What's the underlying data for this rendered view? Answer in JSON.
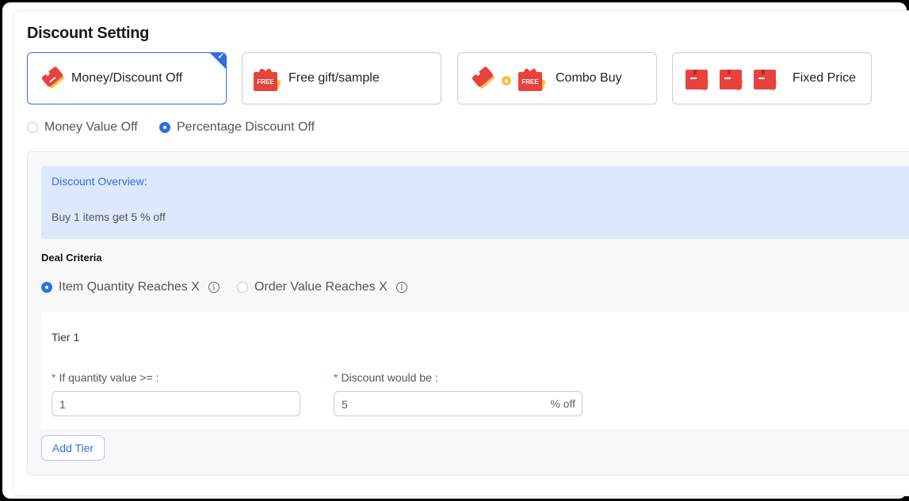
{
  "header": {
    "title": "Discount Setting"
  },
  "discount_types": [
    {
      "label": "Money/Discount Off",
      "icon": "price-tag-icon",
      "selected": true
    },
    {
      "label": "Free gift/sample",
      "icon": "free-gift-icon",
      "selected": false
    },
    {
      "label": "Combo Buy",
      "icon": "combo-icon",
      "selected": false
    },
    {
      "label": "Fixed Price",
      "icon": "fixed-price-icon",
      "selected": false
    }
  ],
  "discount_mode": {
    "options": [
      {
        "label": "Money Value Off",
        "selected": false
      },
      {
        "label": "Percentage Discount Off",
        "selected": true
      }
    ]
  },
  "overview": {
    "title": "Discount Overview:",
    "text": "Buy 1 items get 5 % off"
  },
  "deal_criteria": {
    "title": "Deal Criteria",
    "options": [
      {
        "label": "Item Quantity Reaches X",
        "selected": true
      },
      {
        "label": "Order Value Reaches X",
        "selected": false
      }
    ]
  },
  "tiers": [
    {
      "title": "Tier 1",
      "quantity_label": "If quantity value >= :",
      "quantity_value": "1",
      "discount_label": "Discount would be :",
      "discount_value": "5",
      "discount_suffix": "% off"
    }
  ],
  "add_tier_label": "Add Tier",
  "colors": {
    "accent": "#2f6fe4",
    "icon_red": "#e8423f",
    "icon_yellow": "#f5c242",
    "overview_bg": "#dde8fd",
    "required": "#e2413d"
  }
}
